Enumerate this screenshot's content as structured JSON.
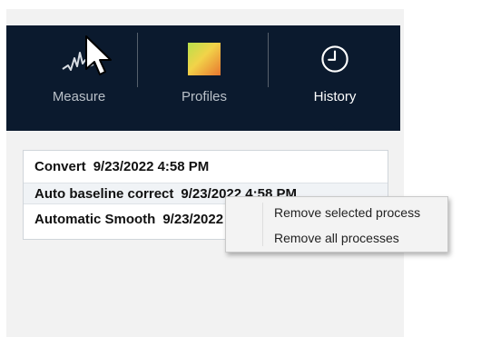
{
  "ribbon": {
    "tabs": [
      {
        "label": "Measure",
        "icon": "waveform-icon"
      },
      {
        "label": "Profiles",
        "icon": "profile-gradient-icon"
      },
      {
        "label": "History",
        "icon": "clock-icon",
        "selected": true
      }
    ]
  },
  "process_list": {
    "items": [
      {
        "name": "Convert",
        "timestamp": "9/23/2022 4:58 PM"
      },
      {
        "name": "Auto baseline correct",
        "timestamp": "9/23/2022 4:58 PM",
        "selected": true
      },
      {
        "name": "Automatic Smooth",
        "timestamp": "9/23/2022 4:58 PM"
      }
    ]
  },
  "context_menu": {
    "items": [
      {
        "label": "Remove selected process"
      },
      {
        "label": "Remove all processes"
      }
    ]
  },
  "colors": {
    "ribbon_background": "#0b1a2e",
    "tab_label": "#b9c0c8",
    "selected_tab_label": "#ffffff",
    "panel_background": "#f2f2f2",
    "context_menu_background": "#f3f3f3"
  }
}
